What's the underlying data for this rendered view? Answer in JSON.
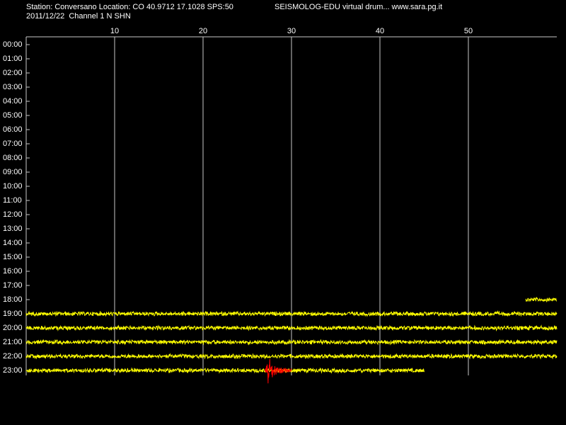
{
  "header": {
    "station_line": "Station: Conversano Location: CO 40.9712 17.1028 SPS:50",
    "date_line": "2011/12/22  Channel 1 N SHN",
    "brand_line": "SEISMOLOG-EDU virtual drum... www.sara.pg.it"
  },
  "minute_ticks": [
    "10",
    "20",
    "30",
    "40",
    "50"
  ],
  "hours": [
    "00:00",
    "01:00",
    "02:00",
    "03:00",
    "04:00",
    "05:00",
    "06:00",
    "07:00",
    "08:00",
    "09:00",
    "10:00",
    "11:00",
    "12:00",
    "13:00",
    "14:00",
    "15:00",
    "16:00",
    "17:00",
    "18:00",
    "19:00",
    "20:00",
    "21:00",
    "22:00",
    "23:00"
  ],
  "colors": {
    "background": "#000000",
    "text": "#ffffff",
    "grid": "#c8c8c8",
    "trace": "#ffff00",
    "event": "#ff0000"
  },
  "traces": [
    {
      "hour": "18:00",
      "start_min": 56.5,
      "end_min": 60
    },
    {
      "hour": "19:00",
      "start_min": 0,
      "end_min": 60
    },
    {
      "hour": "20:00",
      "start_min": 0,
      "end_min": 60
    },
    {
      "hour": "21:00",
      "start_min": 0,
      "end_min": 60
    },
    {
      "hour": "22:00",
      "start_min": 0,
      "end_min": 60
    },
    {
      "hour": "23:00",
      "start_min": 0,
      "end_min": 45
    }
  ],
  "event": {
    "hour": "23:00",
    "start_min": 27,
    "end_min": 30
  }
}
